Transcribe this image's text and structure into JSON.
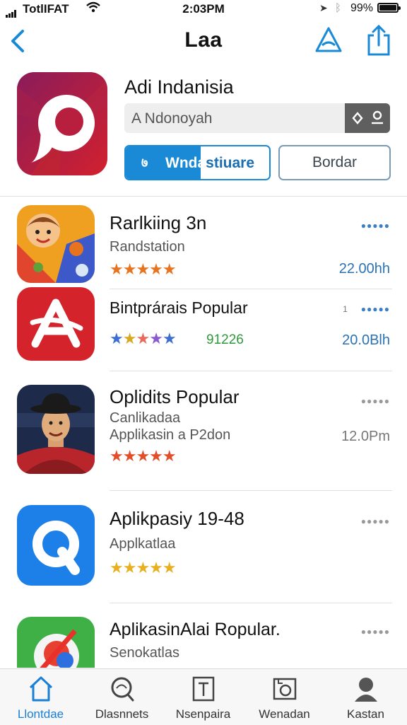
{
  "status": {
    "carrier": "TotlIFAT",
    "time": "2:03PM",
    "battery": "99%"
  },
  "nav": {
    "title": "Laa"
  },
  "hero": {
    "title": "Adi Indanisia",
    "search_text": "A Ndonoyah",
    "primary_ico": "७",
    "primary_label_a": "Wnda",
    "primary_label_b": "stiuare",
    "secondary_label": "Bordar"
  },
  "rows": [
    {
      "name": "Rarlkiing 3n",
      "sub": "Randstation",
      "stars": "★★★★★",
      "meta": "22.00hh"
    },
    {
      "name": "Bintprárais Popular",
      "count": "91226",
      "stars": "★★★★★",
      "meta": "20.0Blh",
      "dots_prefix": "1"
    },
    {
      "name": "Oplidits Popular",
      "sub": "Canlikadaa",
      "sub2": "Applikasin a P2don",
      "stars": "★★★★★",
      "meta": "12.0Pm"
    },
    {
      "name": "Aplikpasiy 19-48",
      "sub": "Applkatlaa",
      "stars": "★★★★★"
    },
    {
      "name": "AplikasinAlai Ropular.",
      "sub": "Senokatlas"
    }
  ],
  "tabs": [
    {
      "label": "Llontdae",
      "icon": "home-icon"
    },
    {
      "label": "Dlasnnets",
      "icon": "search-icon"
    },
    {
      "label": "Nsenpaira",
      "icon": "edit-icon"
    },
    {
      "label": "Wenadan",
      "icon": "photo-icon"
    },
    {
      "label": "Kastan",
      "icon": "person-icon"
    }
  ],
  "colors": {
    "accent": "#1a8ad6",
    "star": "#e8731f",
    "tab_active": "#1a7fd6"
  }
}
